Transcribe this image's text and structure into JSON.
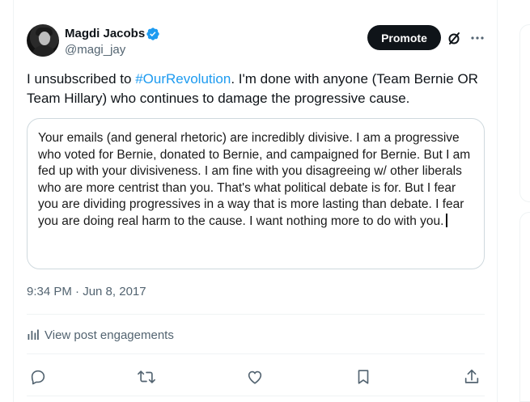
{
  "author": {
    "name": "Magdi Jacobs",
    "handle": "@magi_jay"
  },
  "header": {
    "promote_label": "Promote",
    "grok_icon": "slash-circle-icon",
    "more_icon": "more-horizontal-icon"
  },
  "tweet": {
    "text_before": "I unsubscribed to ",
    "hashtag": "#OurRevolution",
    "text_after": ". I'm done with anyone (Team Bernie OR Team Hillary) who continues to damage the progressive cause."
  },
  "quote": {
    "text": "Your emails (and general rhetoric) are incredibly divisive. I am a progressive who voted for Bernie, donated to Bernie, and campaigned for Bernie. But I am fed up with your divisiveness. I am fine with you disagreeing w/ other liberals who are more centrist than you. That's what political debate is for. But I fear you are dividing progressives in a way that is more lasting than debate. I fear you are doing real harm to the cause.  I want nothing more to do with you."
  },
  "meta": {
    "timestamp": "9:34 PM · Jun 8, 2017"
  },
  "engagements": {
    "label": "View post engagements"
  },
  "actions": [
    "reply-icon",
    "repost-icon",
    "like-icon",
    "bookmark-icon",
    "share-icon"
  ],
  "colors": {
    "accent": "#1d9bf0",
    "text": "#0f1419",
    "muted": "#536471",
    "border": "#eff3f4",
    "promote_bg": "#0f1419"
  }
}
